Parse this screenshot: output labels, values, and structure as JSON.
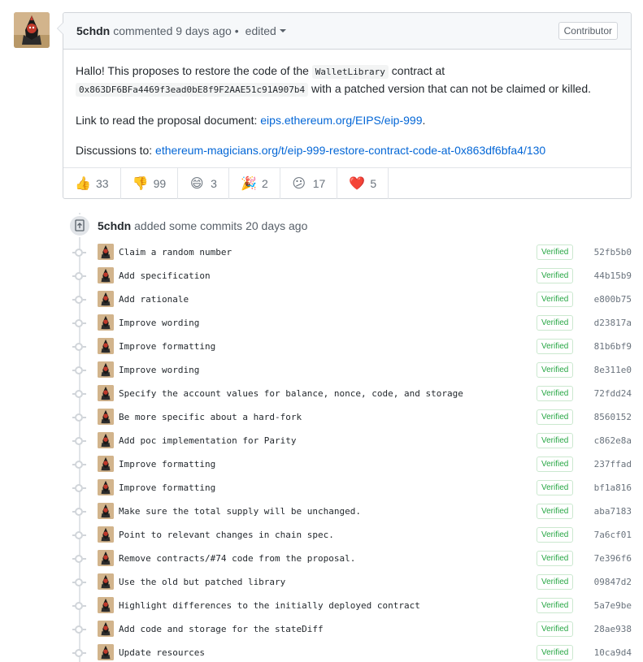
{
  "comment": {
    "author": "5chdn",
    "meta": "commented 9 days ago",
    "separator": "•",
    "edited_label": "edited",
    "role_badge": "Contributor",
    "body": {
      "p1_text_a": "Hallo! This proposes to restore the code of the ",
      "p1_code_a": "WalletLibrary",
      "p1_text_b": " contract at",
      "p1_code_b": "0x863DF6BFa4469f3ead0bE8f9F2AAE51c91A907b4",
      "p1_text_c": " with a patched version that can not be claimed or killed.",
      "p2_text": "Link to read the proposal document: ",
      "p2_link": "eips.ethereum.org/EIPS/eip-999",
      "p2_tail": ".",
      "p3_text": "Discussions to: ",
      "p3_link": "ethereum-magicians.org/t/eip-999-restore-contract-code-at-0x863df6bfa4/130"
    },
    "reactions": [
      {
        "emoji": "👍",
        "icon": "thumbs-up-icon",
        "count": "33"
      },
      {
        "emoji": "👎",
        "icon": "thumbs-down-icon",
        "count": "99"
      },
      {
        "emoji": "😄",
        "icon": "laugh-icon",
        "count": "3"
      },
      {
        "emoji": "🎉",
        "icon": "hooray-icon",
        "count": "2"
      },
      {
        "emoji": "😕",
        "icon": "confused-icon",
        "count": "17"
      },
      {
        "emoji": "❤️",
        "icon": "heart-icon",
        "count": "5"
      }
    ]
  },
  "timeline": {
    "author": "5chdn",
    "action": " added some commits 20 days ago",
    "commits": [
      {
        "message": "Claim a random number",
        "verified": "Verified",
        "sha": "52fb5b0"
      },
      {
        "message": "Add specification",
        "verified": "Verified",
        "sha": "44b15b9"
      },
      {
        "message": "Add rationale",
        "verified": "Verified",
        "sha": "e800b75"
      },
      {
        "message": "Improve wording",
        "verified": "Verified",
        "sha": "d23817a"
      },
      {
        "message": "Improve formatting",
        "verified": "Verified",
        "sha": "81b6bf9"
      },
      {
        "message": "Improve wording",
        "verified": "Verified",
        "sha": "8e311e0"
      },
      {
        "message": "Specify the account values for balance, nonce, code, and storage",
        "verified": "Verified",
        "sha": "72fdd24"
      },
      {
        "message": "Be more specific about a hard-fork",
        "verified": "Verified",
        "sha": "8560152"
      },
      {
        "message": "Add poc implementation for Parity",
        "verified": "Verified",
        "sha": "c862e8a"
      },
      {
        "message": "Improve formatting",
        "verified": "Verified",
        "sha": "237ffad"
      },
      {
        "message": "Improve formatting",
        "verified": "Verified",
        "sha": "bf1a816"
      },
      {
        "message": "Make sure the total supply will be unchanged.",
        "verified": "Verified",
        "sha": "aba7183"
      },
      {
        "message": "Point to relevant changes in chain spec.",
        "verified": "Verified",
        "sha": "7a6cf01"
      },
      {
        "message": "Remove contracts/#74 code from the proposal.",
        "verified": "Verified",
        "sha": "7e396f6"
      },
      {
        "message": "Use the old but patched library",
        "verified": "Verified",
        "sha": "09847d2"
      },
      {
        "message": "Highlight differences to the initially deployed contract",
        "verified": "Verified",
        "sha": "5a7e9be"
      },
      {
        "message": "Add code and storage for the stateDiff",
        "verified": "Verified",
        "sha": "28ae938"
      },
      {
        "message": "Update resources",
        "verified": "Verified",
        "sha": "10ca9d4"
      }
    ]
  },
  "colors": {
    "link": "#0366d6",
    "verified": "#28a745",
    "border": "#d1d5da",
    "header_bg": "#f6f8fa"
  }
}
